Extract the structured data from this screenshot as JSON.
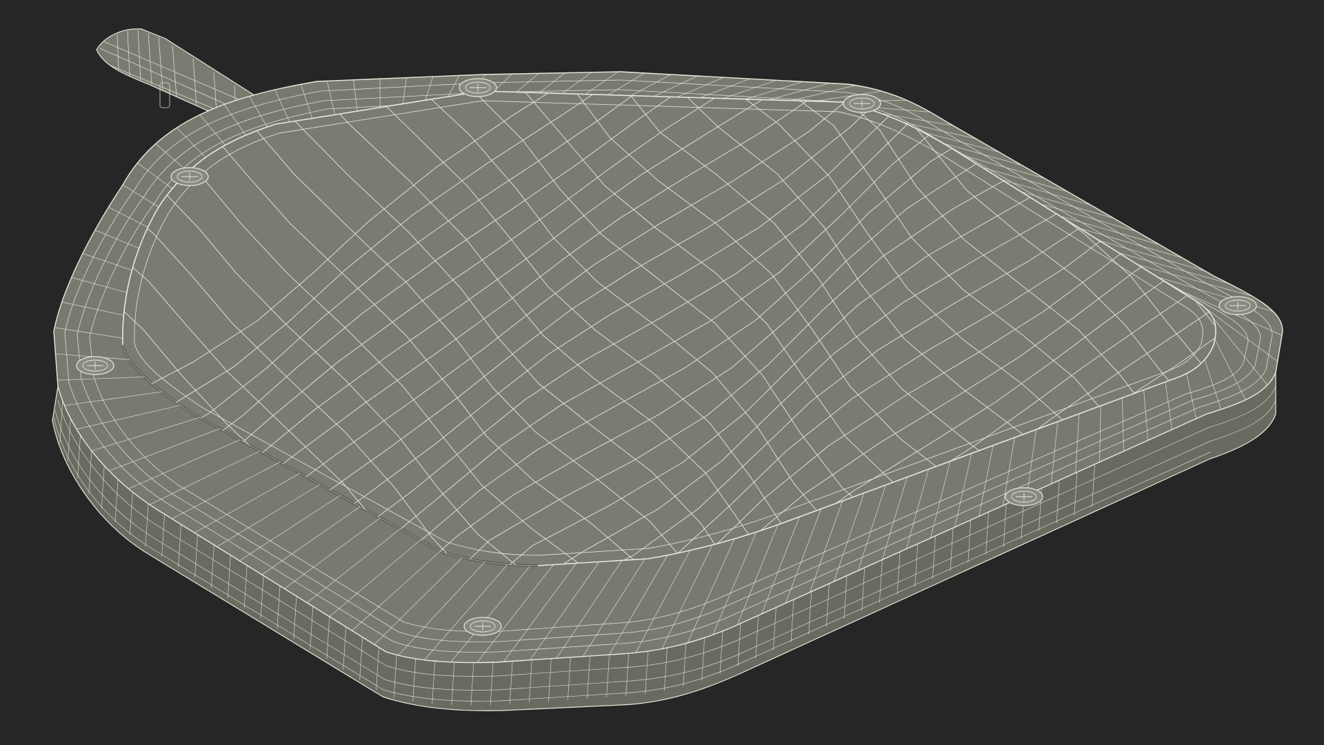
{
  "scene": {
    "background_color": "#262626",
    "object": "paddle",
    "render_style": "wireframe",
    "surface_color": "#797a6f",
    "side_color": "#6d6e64",
    "wire_color": "#e9e9dc",
    "screw_count": 7,
    "has_handle": true
  }
}
